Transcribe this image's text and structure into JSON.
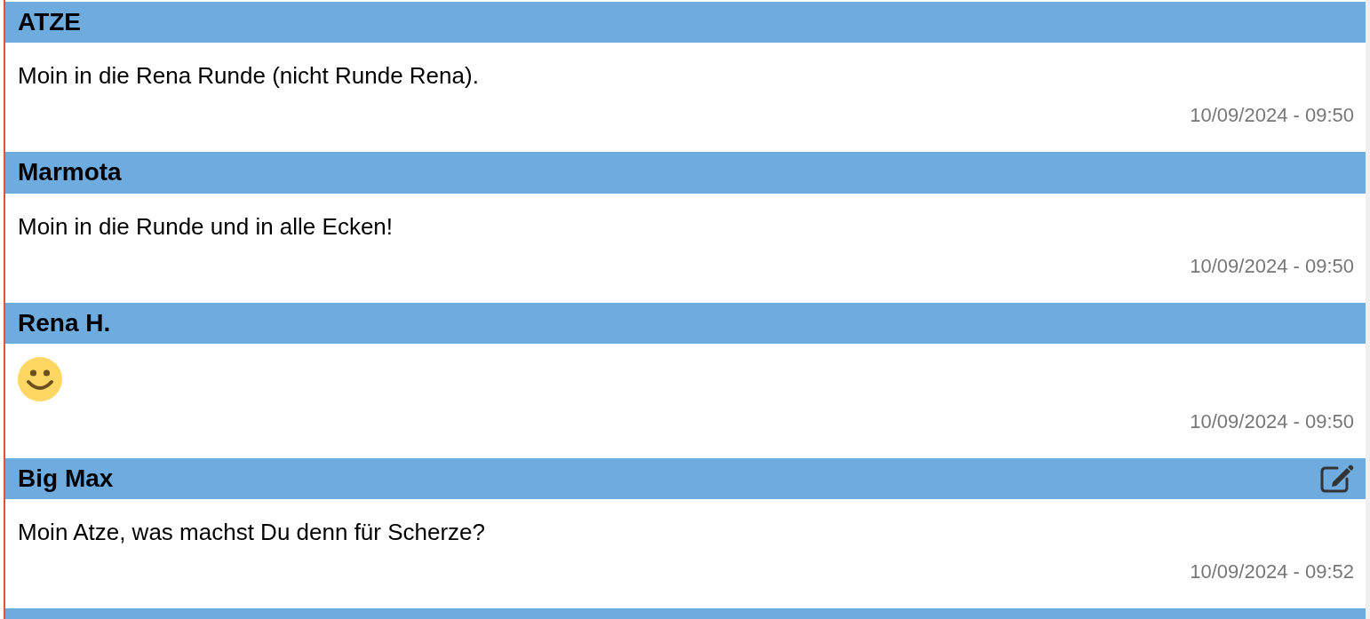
{
  "messages": [
    {
      "author": "ATZE",
      "kind": "text",
      "text": "Moin in die Rena Runde (nicht Runde Rena).",
      "time": "10/09/2024 - 09:50",
      "editable": false
    },
    {
      "author": "Marmota",
      "kind": "text",
      "text": "Moin in die Runde und in alle Ecken!",
      "time": "10/09/2024 - 09:50",
      "editable": false
    },
    {
      "author": "Rena H.",
      "kind": "emoji",
      "time": "10/09/2024 - 09:50",
      "editable": false
    },
    {
      "author": "Big Max",
      "kind": "text",
      "text": "Moin Atze, was machst Du denn für Scherze?",
      "time": "10/09/2024 - 09:52",
      "editable": true
    }
  ],
  "next_message_partial": true
}
